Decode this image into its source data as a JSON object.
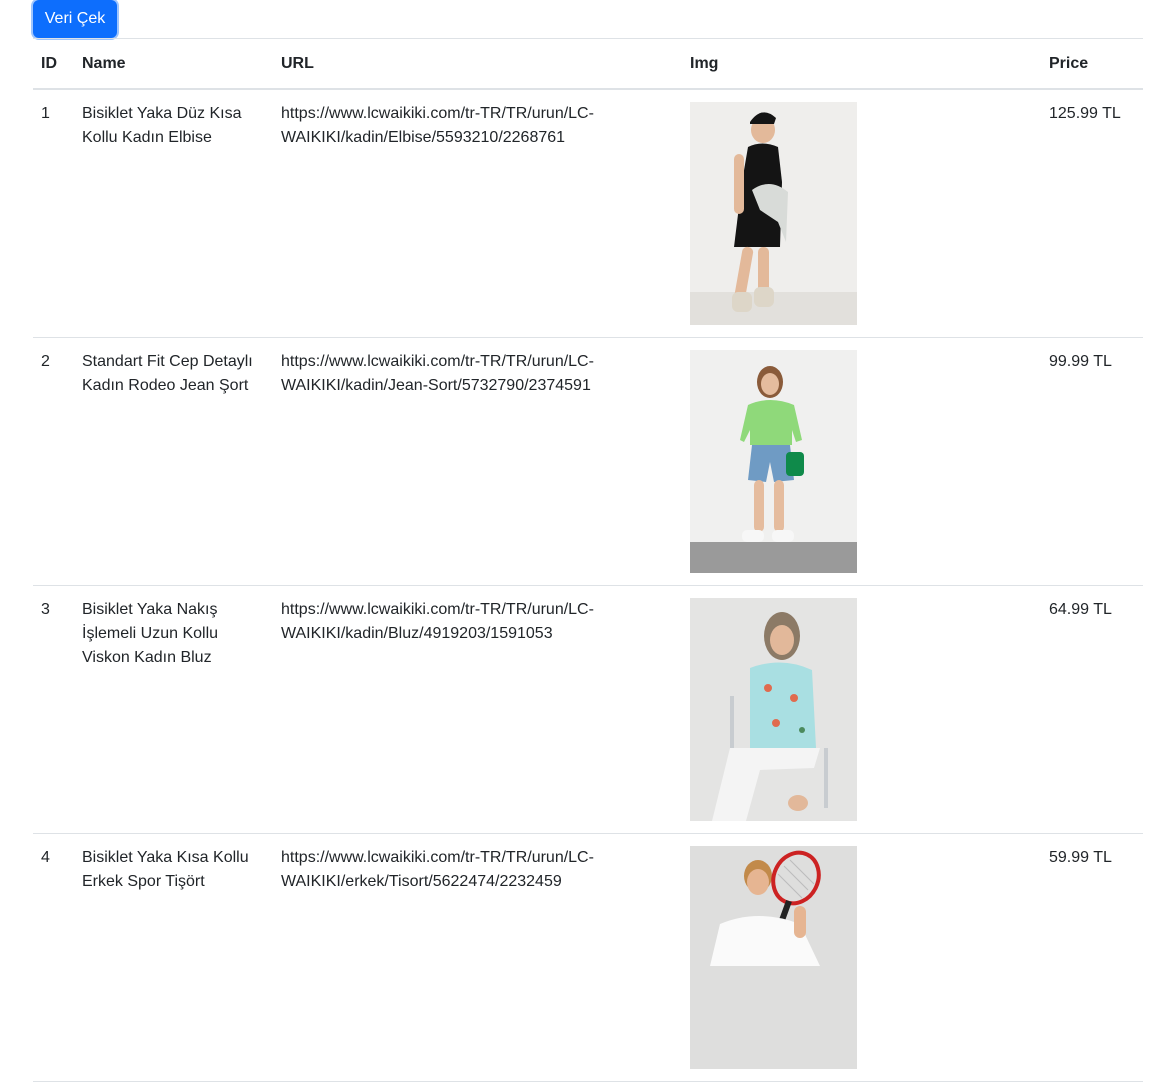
{
  "toolbar": {
    "fetch_label": "Veri Çek"
  },
  "table": {
    "headers": [
      "ID",
      "Name",
      "URL",
      "Img",
      "Price"
    ],
    "rows": [
      {
        "id": "1",
        "name": "Bisiklet Yaka Düz Kısa Kollu Kadın Elbise",
        "url": "https://www.lcwaikiki.com/tr-TR/TR/urun/LC-WAIKIKI/kadin/Elbise/5593210/2268761",
        "img_alt": "woman in black dress photo",
        "price": "125.99 TL"
      },
      {
        "id": "2",
        "name": "Standart Fit Cep Detaylı Kadın Rodeo Jean Şort",
        "url": "https://www.lcwaikiki.com/tr-TR/TR/urun/LC-WAIKIKI/kadin/Jean-Sort/5732790/2374591",
        "img_alt": "woman in green jacket and denim shorts photo",
        "price": "99.99 TL"
      },
      {
        "id": "3",
        "name": "Bisiklet Yaka Nakış İşlemeli Uzun Kollu Viskon Kadın Bluz",
        "url": "https://www.lcwaikiki.com/tr-TR/TR/urun/LC-WAIKIKI/kadin/Bluz/4919203/1591053",
        "img_alt": "woman in floral blouse seated on chair photo",
        "price": "64.99 TL"
      },
      {
        "id": "4",
        "name": "Bisiklet Yaka Kısa Kollu Erkek Spor Tişört",
        "url": "https://www.lcwaikiki.com/tr-TR/TR/urun/LC-WAIKIKI/erkek/Tisort/5622474/2232459",
        "img_alt": "man in white t-shirt holding tennis racket photo",
        "price": "59.99 TL"
      }
    ]
  },
  "colors": {
    "accent": "#0d6efd",
    "border": "#dee2e6",
    "text": "#212529"
  }
}
